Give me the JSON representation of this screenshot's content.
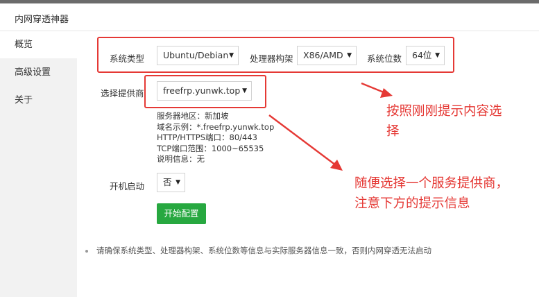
{
  "window": {
    "title": "内网穿透神器"
  },
  "sidebar": {
    "items": [
      {
        "label": "概览",
        "active": true
      },
      {
        "label": "高级设置",
        "active": false
      },
      {
        "label": "关于",
        "active": false
      }
    ]
  },
  "form": {
    "system_type": {
      "label": "系统类型",
      "value": "Ubuntu/Debian"
    },
    "cpu_arch": {
      "label": "处理器构架",
      "value": "X86/AMD"
    },
    "system_bits": {
      "label": "系统位数",
      "value": "64位"
    },
    "provider": {
      "label": "选择提供商",
      "value": "freefrp.yunwk.top"
    },
    "provider_info": [
      "服务器地区：新加坡",
      "域名示例：*.freefrp.yunwk.top",
      "HTTP/HTTPS端口：80/443",
      "TCP端口范围：1000~65535",
      "说明信息：无"
    ],
    "autostart": {
      "label": "开机启动",
      "value": "否"
    },
    "start_button": "开始配置"
  },
  "note": "请确保系统类型、处理器构架、系统位数等信息与实际服务器信息一致，否则内网穿透无法启动",
  "annotations": {
    "top_right_line1": "按照刚刚提示内容选",
    "top_right_line2": "择",
    "bottom_right_line1": "随便选择一个服务提供商，",
    "bottom_right_line2": "注意下方的提示信息"
  },
  "colors": {
    "accent_green": "#27a840",
    "annotation_red": "#e53935",
    "sidebar_bg": "#f2f2f2"
  },
  "icons": {
    "dropdown": "caret-down-icon",
    "arrow": "red-arrow-icon"
  }
}
